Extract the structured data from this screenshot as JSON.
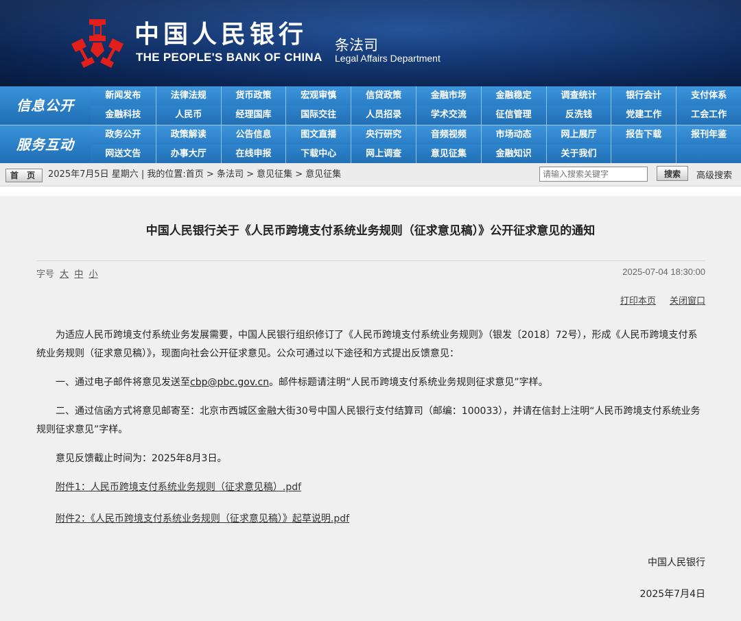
{
  "header": {
    "bank_name_cn": "中国人民银行",
    "bank_name_en": "THE PEOPLE'S BANK OF CHINA",
    "dept_cn": "条法司",
    "dept_en": "Legal Affairs Department",
    "logo_icon": "pboc-logo-icon",
    "logo_color": "#e31f1c",
    "banner_color": "#163b78"
  },
  "nav": {
    "accent_color": "#2d82c8",
    "categories": [
      {
        "label": "信息公开",
        "rows": [
          [
            "新闻发布",
            "法律法规",
            "货币政策",
            "宏观审慎",
            "信贷政策",
            "金融市场",
            "金融稳定",
            "调查统计",
            "银行会计",
            "支付体系"
          ],
          [
            "金融科技",
            "人民币",
            "经理国库",
            "国际交往",
            "人员招录",
            "学术交流",
            "征信管理",
            "反洗钱",
            "党建工作",
            "工会工作"
          ]
        ]
      },
      {
        "label": "服务互动",
        "rows": [
          [
            "政务公开",
            "政策解读",
            "公告信息",
            "图文直播",
            "央行研究",
            "音频视频",
            "市场动态",
            "网上展厅",
            "报告下载",
            "报刊年鉴"
          ],
          [
            "网送文告",
            "办事大厅",
            "在线申报",
            "下载中心",
            "网上调查",
            "意见征集",
            "金融知识",
            "关于我们",
            "",
            ""
          ]
        ]
      }
    ]
  },
  "statusbar": {
    "home_label": "首 页",
    "date_and_location": "2025年7月5日 星期六 | 我的位置:首页 > 条法司 > 意见征集 > 意见征集",
    "search_placeholder": "请输入搜索关键字",
    "search_button": "搜索",
    "advanced_search": "高级搜索"
  },
  "article": {
    "title": "中国人民银行关于《人民币跨境支付系统业务规则（征求意见稿）》公开征求意见的通知",
    "font_size_label": "字号",
    "font_size_large": "大",
    "font_size_medium": "中",
    "font_size_small": "小",
    "publish_time": "2025-07-04 18:30:00",
    "print_label": "打印本页",
    "close_label": "关闭窗口",
    "para1": "为适应人民币跨境支付系统业务发展需要，中国人民银行组织修订了《人民币跨境支付系统业务规则》（银发〔2018〕72号），形成《人民币跨境支付系统业务规则（征求意见稿）》，现面向社会公开征求意见。公众可通过以下途径和方式提出反馈意见：",
    "para2_prefix": "一、通过电子邮件将意见发送至",
    "email": "cbp@pbc.gov.cn",
    "para2_suffix": "。邮件标题请注明“人民币跨境支付系统业务规则征求意见”字样。",
    "para3": "二、通过信函方式将意见邮寄至：北京市西城区金融大街30号中国人民银行支付结算司（邮编：100033），并请在信封上注明“人民币跨境支付系统业务规则征求意见”字样。",
    "para4": "意见反馈截止时间为：2025年8月3日。",
    "attachment1": "附件1：人民币跨境支付系统业务规则（征求意见稿）.pdf",
    "attachment2": "附件2：《人民币跨境支付系统业务规则（征求意见稿）》起草说明.pdf",
    "signature": "中国人民银行",
    "sign_date": "2025年7月4日"
  }
}
